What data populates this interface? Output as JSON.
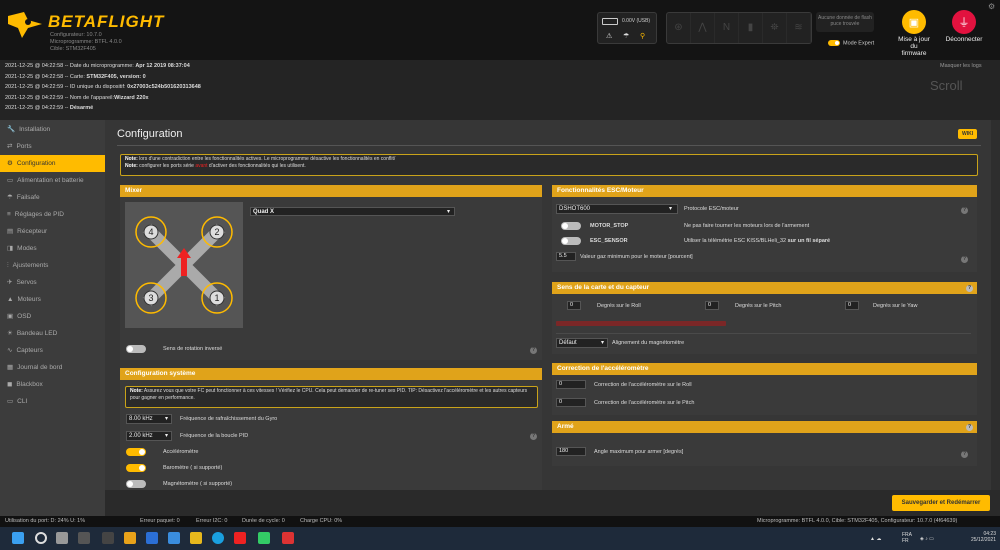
{
  "header": {
    "brand": "BETAFLIGHT",
    "configurator": "Configurateur: 10.7.0",
    "firmware": "Microprogramme: BTFL 4.0.0",
    "target": "Cible: STM32F405",
    "battery": "0.00V (USB)",
    "flash": "Aucune donnée de flash puce trouvée",
    "expert": "Mode Expert",
    "update_fw": "Mise à jour du firmware",
    "disconnect": "Déconnecter",
    "colors": {
      "accent": "#ffbb00",
      "disconnect": "#e2123f"
    }
  },
  "logs": {
    "lines": [
      {
        "ts": "2021-12-25 @ 04:22:58 -- ",
        "msg": "Date du microprogramme: ",
        "val": "Apr 12 2019 08:37:04"
      },
      {
        "ts": "2021-12-25 @ 04:22:58 -- ",
        "msg": "Carte: ",
        "val": "STM32F405, version: 0"
      },
      {
        "ts": "2021-12-25 @ 04:22:59 -- ",
        "msg": "ID unique du dispositif: ",
        "val": "0x27003c524b501620313648"
      },
      {
        "ts": "2021-12-25 @ 04:22:59 -- ",
        "msg": "Nom de l'appareil:",
        "val": "Wizzard 220x"
      },
      {
        "ts": "2021-12-25 @ 04:22:59 -- ",
        "msg": "",
        "val": "Désarmé"
      }
    ],
    "hide": "Masquer les logs",
    "scroll": "Scroll"
  },
  "sidebar": {
    "items": [
      {
        "label": "Installation",
        "icon": "wrench-icon",
        "glyph": "🔧"
      },
      {
        "label": "Ports",
        "icon": "ports-icon",
        "glyph": "⇄"
      },
      {
        "label": "Configuration",
        "icon": "gear-icon",
        "glyph": "⚙"
      },
      {
        "label": "Alimentation et batterie",
        "icon": "battery-icon",
        "glyph": "▭"
      },
      {
        "label": "Failsafe",
        "icon": "failsafe-icon",
        "glyph": "☂"
      },
      {
        "label": "Réglages de PID",
        "icon": "pid-icon",
        "glyph": "≡"
      },
      {
        "label": "Récepteur",
        "icon": "receiver-icon",
        "glyph": "▤"
      },
      {
        "label": "Modes",
        "icon": "modes-icon",
        "glyph": "◨"
      },
      {
        "label": "Ajustements",
        "icon": "adjustments-icon",
        "glyph": "⫶"
      },
      {
        "label": "Servos",
        "icon": "servo-icon",
        "glyph": "✈"
      },
      {
        "label": "Moteurs",
        "icon": "motor-icon",
        "glyph": "▲"
      },
      {
        "label": "OSD",
        "icon": "osd-icon",
        "glyph": "▣"
      },
      {
        "label": "Bandeau LED",
        "icon": "led-icon",
        "glyph": "☀"
      },
      {
        "label": "Capteurs",
        "icon": "sensors-icon",
        "glyph": "∿"
      },
      {
        "label": "Journal de bord",
        "icon": "log-icon",
        "glyph": "▦"
      },
      {
        "label": "Blackbox",
        "icon": "blackbox-icon",
        "glyph": "◼"
      },
      {
        "label": "CLI",
        "icon": "cli-icon",
        "glyph": "▭"
      }
    ]
  },
  "page": {
    "title": "Configuration",
    "wiki": "WIKI",
    "note1_b": "Note:",
    "note1_t": " lors d'une contradiction entre les fonctionnalités actives. Le microprogramme désactive les fonctionnalités en conflit/",
    "note2_b": "Note:",
    "note2_t1": " configurer les ports série ",
    "note2_red": "avant",
    "note2_t2": " d'activer des fonctionnalités qui les utilisent."
  },
  "mixer": {
    "title": "Mixer",
    "type": "Quad X",
    "reverse": "Sens de rotation inversé",
    "motors": [
      "4",
      "2",
      "3",
      "1"
    ]
  },
  "system": {
    "title": "Configuration système",
    "note_b": "Note:",
    "note_t": " Assurez vous que votre FC peut fonctionner à ces vitesses ! Vérifiez le CPU. Cela peut demander de re-tuner ses PID. TIP: Désactivez l'accéléromètre et les autres capteurs pour gagner en performance.",
    "gyro_val": "8.00 kHz",
    "gyro_lbl": "Fréquence de rafraîchissement du Gyro",
    "pid_val": "2.00 kHz",
    "pid_lbl": "Fréquence de la boucle PID",
    "acc": "Accéléromètre",
    "baro": "Baromètre ( si supporté)",
    "mag": "Magnétomètre ( si supporté)"
  },
  "esc": {
    "title": "Fonctionnalités ESC/Moteur",
    "protocol": "DSHOT600",
    "protocol_lbl": "Protocole ESC/moteur",
    "motor_stop": "MOTOR_STOP",
    "motor_stop_desc": "Ne pas faire tourner les moteurs lors de l'armement",
    "esc_sensor": "ESC_SENSOR",
    "esc_sensor_desc": "Utiliser la télémétrie ESC KISS/BLHeli_32 ",
    "esc_sensor_b": "sur un fil séparé",
    "idle_val": "5.5",
    "idle_lbl": "Valeur gaz minimum pour le moteur [pourcent]"
  },
  "board": {
    "title": "Sens de la carte et du capteur",
    "roll": "Degrés sur le Roll",
    "pitch": "Degrés sur le Pitch",
    "yaw": "Degrés sur le Yaw",
    "roll_v": "0",
    "pitch_v": "0",
    "yaw_v": "0",
    "mag_val": "Défaut",
    "mag_lbl": "Alignement du magnétomètre"
  },
  "acc": {
    "title": "Correction de l'accéléromètre",
    "roll_v": "0",
    "roll": "Correction de l'accéléromètre sur le Roll",
    "pitch_v": "0",
    "pitch": "Correction de l'accéléromètre sur le Pitch"
  },
  "arm": {
    "title": "Armé",
    "val": "180",
    "lbl": "Angle maximum pour armer [degrés]"
  },
  "save": "Sauvegarder et Redémarrer",
  "status": {
    "port": "Utilisation du port: D: 24% U: 1%",
    "packet": "Erreur paquet: 0",
    "i2c": "Erreur I2C: 0",
    "cycle": "Durée de cycle: 0",
    "cpu": "Charge CPU: 0%",
    "right": "Microprogramme: BTFL 4.0.0, Cible: STM32F405, Configurateur: 10.7.0 (4f64639)"
  },
  "taskbar": {
    "lang1": "FRA",
    "lang2": "FR",
    "time": "04:23",
    "date": "25/12/2021"
  }
}
